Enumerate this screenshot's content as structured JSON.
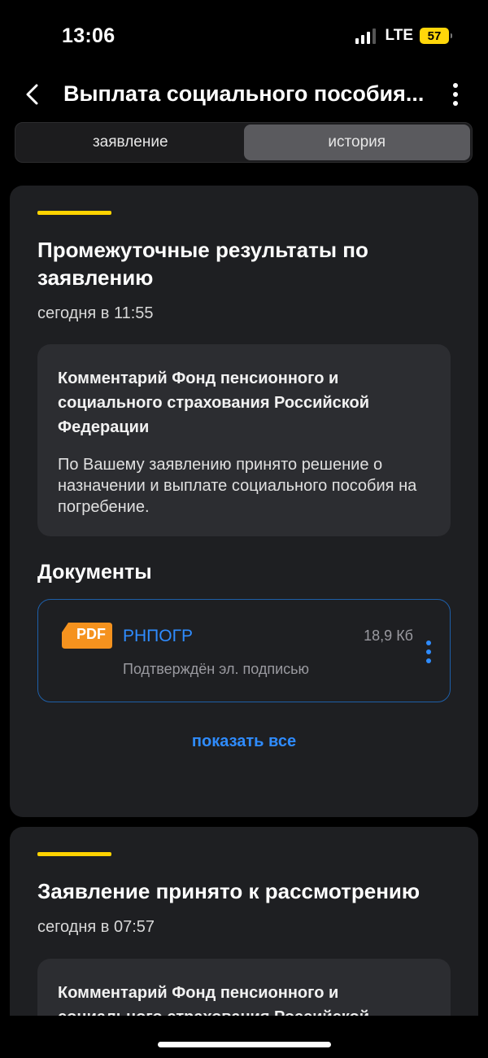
{
  "status": {
    "time": "13:06",
    "network": "LTE",
    "battery": "57"
  },
  "nav": {
    "title": "Выплата социального пособия..."
  },
  "tabs": [
    {
      "label": "заявление",
      "active": false
    },
    {
      "label": "история",
      "active": true
    }
  ],
  "cards": [
    {
      "title": "Промежуточные результаты по заявлению",
      "time": "сегодня в 11:55",
      "comment_title": "Комментарий Фонд пенсионного и социального страхования Российской Федерации",
      "comment_text": "По Вашему заявлению принято решение о назначении и выплате социального пособия на погребение.",
      "documents_heading": "Документы",
      "document": {
        "badge": "PDF",
        "name": "РНПОГР",
        "size": "18,9 Кб",
        "status": "Подтверждён эл. подписью"
      },
      "show_all": "показать все"
    },
    {
      "title": "Заявление принято к рассмотрению",
      "time": "сегодня в 07:57",
      "comment_title": "Комментарий Фонд пенсионного и социального страхования Российской"
    }
  ],
  "colors": {
    "accent": "#FFD300",
    "link": "#2f8cff",
    "pdf": "#F5921E",
    "card": "#1e1f22"
  }
}
